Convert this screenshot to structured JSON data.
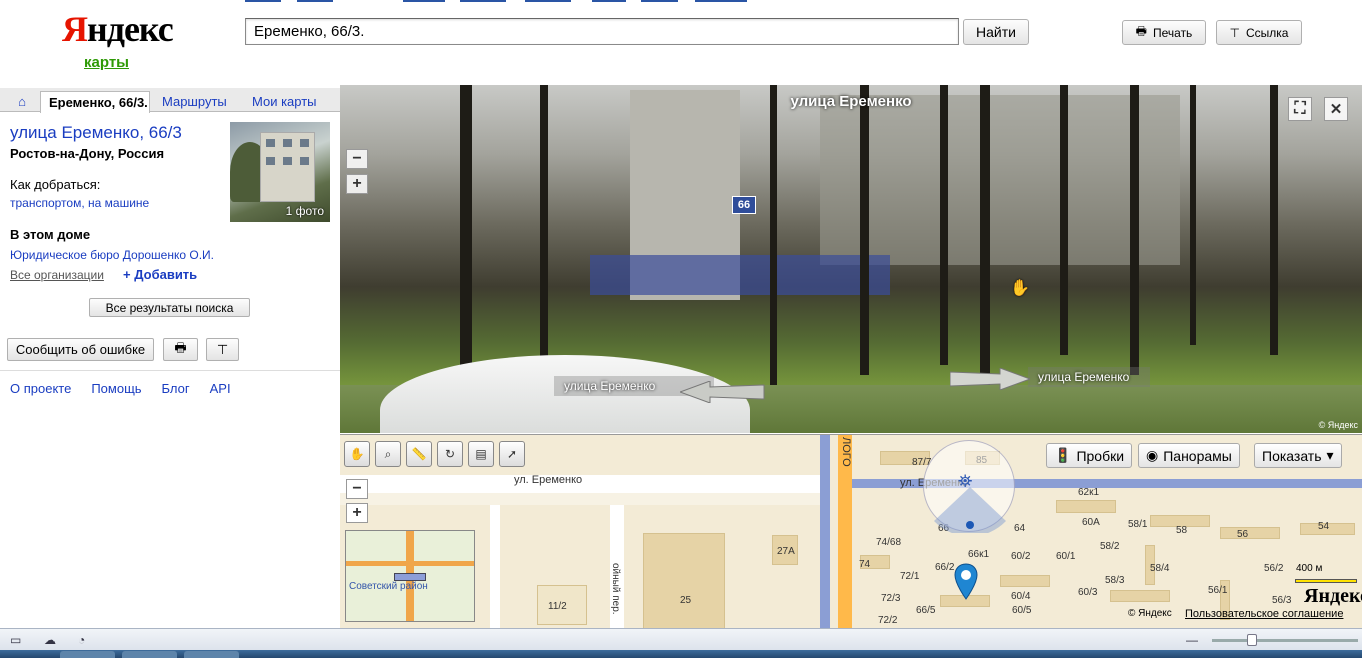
{
  "header": {
    "logo_ya": "Я",
    "logo_rest": "ндекс",
    "logo_sub": "карты",
    "search_value": "Еременко, 66/3.",
    "search_button": "Найти",
    "print_label": "Печать",
    "link_label": "Ссылка"
  },
  "sidebar": {
    "tabs": {
      "active": "Еременко, 66/3.",
      "routes": "Маршруты",
      "mymaps": "Мои карты"
    },
    "place_title": "улица Еременко, 66/3",
    "place_city": "Ростов-на-Дону, Россия",
    "photo_count": "1 фото",
    "howto_label": "Как добраться:",
    "howto_links": "транспортом, на машине",
    "inhouse_label": "В этом доме",
    "org": "Юридическое бюро Дорошенко О.И.",
    "all_orgs": "Все организации",
    "add_org": "+ Добавить",
    "all_results": "Все результаты поиска",
    "report_error": "Сообщить об ошибке",
    "footer_links": [
      "О проекте",
      "Помощь",
      "Блог",
      "API"
    ]
  },
  "panorama": {
    "title": "улица Еременко",
    "house_number": "66",
    "street_left": "улица Еременко",
    "street_right": "улица Еременко",
    "copyright": "© Яндекс"
  },
  "map": {
    "street_name": "ул. Еременко",
    "street_name_2": "ул. Еременко",
    "district": "Советский район",
    "traffic_btn": "Пробки",
    "panoramas_btn": "Панорамы",
    "show_btn": "Показать",
    "scale": "400 м",
    "logo": "Яндекс",
    "copyright": "© Яндекс",
    "terms": "Пользовательское соглашение",
    "labels": [
      "87/7",
      "85",
      "62к1",
      "66",
      "74/68",
      "64",
      "60А",
      "58/1",
      "58",
      "54",
      "66к1",
      "60/2",
      "60/1",
      "58/2",
      "56",
      "74",
      "66/2",
      "58/4",
      "56/2",
      "72/1",
      "58/3",
      "72/3",
      "60/4",
      "60/3",
      "56/1",
      "72/2",
      "66/5",
      "60/5",
      "56/3",
      "27А",
      "11/2",
      "25",
      "ойный пер.",
      "ЛОГО",
      "Л"
    ]
  }
}
